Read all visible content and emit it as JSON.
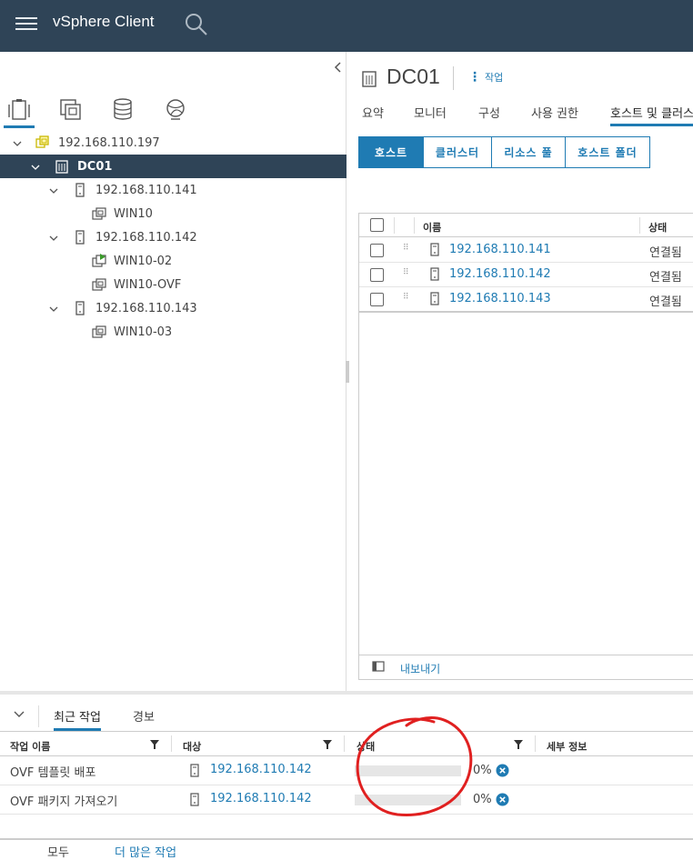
{
  "header": {
    "app_title": "vSphere Client"
  },
  "nav": {
    "tabs": [
      "hosts-and-clusters-icon",
      "vms-and-templates-icon",
      "storage-icon",
      "networking-icon"
    ],
    "tree": [
      {
        "label": "192.168.110.197",
        "type": "vcenter",
        "expanded": true
      },
      {
        "label": "DC01",
        "type": "datacenter",
        "expanded": true,
        "selected": true
      },
      {
        "label": "192.168.110.141",
        "type": "host",
        "expanded": true
      },
      {
        "label": "WIN10",
        "type": "vm"
      },
      {
        "label": "192.168.110.142",
        "type": "host",
        "expanded": true
      },
      {
        "label": "WIN10-02",
        "type": "vm-running"
      },
      {
        "label": "WIN10-OVF",
        "type": "vm"
      },
      {
        "label": "192.168.110.143",
        "type": "host",
        "expanded": true
      },
      {
        "label": "WIN10-03",
        "type": "vm"
      }
    ]
  },
  "main": {
    "title": "DC01",
    "actions_label": "작업",
    "tabs": [
      "요약",
      "모니터",
      "구성",
      "사용 권한",
      "호스트 및 클러스"
    ],
    "active_tab": "호스트 및 클러스",
    "segments": [
      "호스트",
      "클러스터",
      "리소스 풀",
      "호스트 폴더"
    ],
    "active_segment": "호스트",
    "grid": {
      "col_name": "이름",
      "col_state": "상태",
      "rows": [
        {
          "name": "192.168.110.141",
          "state": "연결됨"
        },
        {
          "name": "192.168.110.142",
          "state": "연결됨"
        },
        {
          "name": "192.168.110.143",
          "state": "연결됨"
        }
      ],
      "export_label": "내보내기"
    }
  },
  "bottom": {
    "tabs": [
      "최근 작업",
      "경보"
    ],
    "active_tab": "최근 작업",
    "columns": {
      "task_name": "작업 이름",
      "target": "대상",
      "status": "상태",
      "details": "세부 정보"
    },
    "tasks": [
      {
        "name": "OVF 템플릿 배포",
        "target": "192.168.110.142",
        "progress": 0,
        "percent": "0%"
      },
      {
        "name": "OVF 패키지 가져오기",
        "target": "192.168.110.142",
        "progress": 0,
        "percent": "0%"
      }
    ],
    "footer_left": "모두",
    "footer_link": "더 많은 작업"
  },
  "colors": {
    "header_bg": "#2f4457",
    "accent": "#1f7bb3",
    "annotation": "#e02020"
  }
}
